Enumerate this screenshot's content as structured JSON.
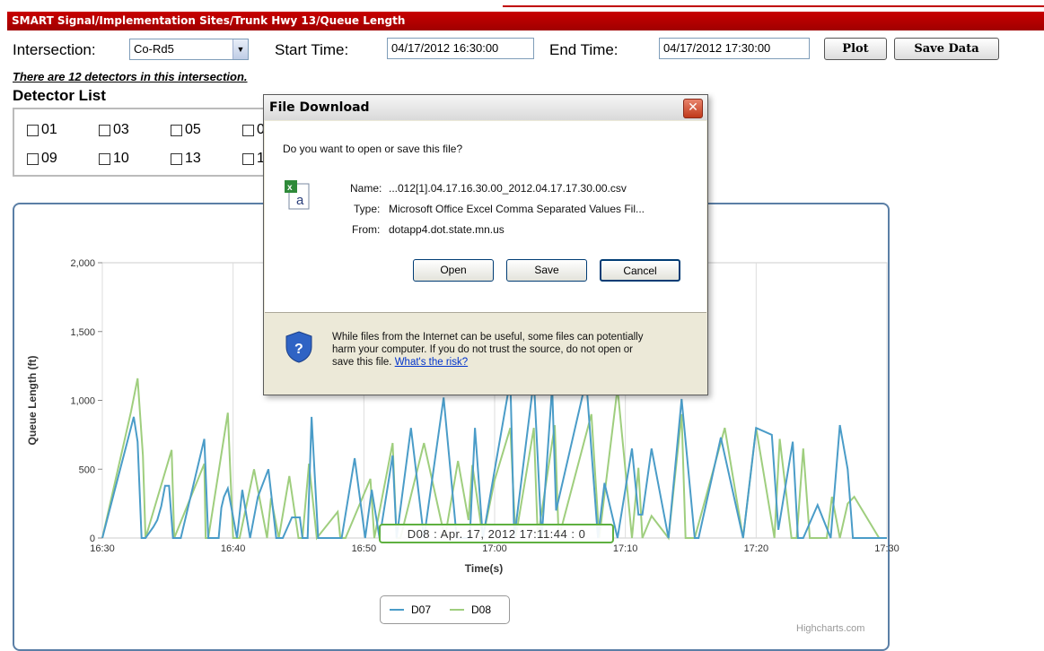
{
  "window": {
    "title": "SMART Signal/Implementation Sites/Trunk Hwy 13/Queue Length"
  },
  "controls": {
    "intersection_label": "Intersection:",
    "intersection_value": "Co-Rd5",
    "start_label": "Start Time:",
    "start_value": "04/17/2012 16:30:00",
    "end_label": "End Time:",
    "end_value": "04/17/2012 17:30:00",
    "plot_label": "Plot",
    "save_data_label": "Save Data"
  },
  "info": {
    "detector_count_text": "There are 12 detectors in this intersection.",
    "detector_list_title": "Detector List"
  },
  "detectors": {
    "row1": [
      "01",
      "03",
      "05",
      "0"
    ],
    "row2": [
      "09",
      "10",
      "13",
      "1"
    ]
  },
  "dialog": {
    "title": "File Download",
    "question": "Do you want to open or save this file?",
    "name_label": "Name:",
    "name_value": "...012[1].04.17.16.30.00_2012.04.17.17.30.00.csv",
    "type_label": "Type:",
    "type_value": "Microsoft Office Excel Comma Separated Values Fil...",
    "from_label": "From:",
    "from_value": "dotapp4.dot.state.mn.us",
    "open_label": "Open",
    "save_label": "Save",
    "cancel_label": "Cancel",
    "warning_line1": "While files from the Internet can be useful, some files can potentially",
    "warning_line2": "harm your computer. If you do not trust the source, do not open or",
    "warning_line3": "save this file.",
    "risk_link": "What's the risk?"
  },
  "tooltip": {
    "text": "D08 : Apr. 17, 2012 17:11:44 : 0"
  },
  "credits": "Highcharts.com",
  "colors": {
    "title_bar": "#b80000",
    "series_d07": "#4a9cc8",
    "series_d08": "#9fce7e",
    "chart_border": "#5b7fa6"
  },
  "chart_data": {
    "type": "line",
    "ylabel": "Queue Length (ft)",
    "xlabel": "Time(s)",
    "ylim": [
      0,
      2000
    ],
    "yticks": [
      "0",
      "500",
      "1,000",
      "1,500",
      "2,000"
    ],
    "xticks": [
      "16:30",
      "16:40",
      "16:50",
      "17:00",
      "17:10",
      "17:20",
      "17:30"
    ],
    "series": [
      {
        "name": "D07",
        "color": "#4a9cc8",
        "x": [
          0,
          2.4,
          2.7,
          3.0,
          3.3,
          3.9,
          4.2,
          4.5,
          4.8,
          5.1,
          5.4,
          6.0,
          7.8,
          8.1,
          8.9,
          9.1,
          9.3,
          9.6,
          10.3,
          10.7,
          11.3,
          11.9,
          12.7,
          13.3,
          13.8,
          14.5,
          15.1,
          15.3,
          15.5,
          15.7,
          16.0,
          16.5,
          18.0,
          18.3,
          19.3,
          20.1,
          20.6,
          21.2,
          22.2,
          22.5,
          23.6,
          24.6,
          26.1,
          27.1,
          28.1,
          28.5,
          29.1,
          31.2,
          31.5,
          33.0,
          33.6,
          34.4,
          34.7,
          37.0,
          37.9,
          38.4,
          39.4,
          40.5,
          41.0,
          41.3,
          42.0,
          43.3,
          44.3,
          45.3,
          45.6,
          47.3,
          49.0,
          50.0,
          51.2,
          51.7,
          52.8,
          53.2,
          53.6,
          54.7,
          55.7,
          56.4,
          57.0,
          57.4,
          58.2,
          59.2,
          60.0
        ],
        "y": [
          0,
          880,
          700,
          0,
          0,
          80,
          130,
          230,
          380,
          380,
          0,
          0,
          720,
          0,
          0,
          220,
          300,
          360,
          0,
          350,
          0,
          300,
          500,
          0,
          0,
          150,
          150,
          0,
          0,
          0,
          880,
          0,
          0,
          0,
          580,
          0,
          350,
          0,
          600,
          0,
          800,
          0,
          1020,
          0,
          0,
          800,
          0,
          1150,
          0,
          1150,
          0,
          1100,
          200,
          1150,
          0,
          400,
          0,
          650,
          170,
          170,
          650,
          0,
          1010,
          0,
          0,
          730,
          0,
          800,
          750,
          60,
          700,
          0,
          0,
          240,
          0,
          820,
          500,
          0,
          0,
          0,
          0
        ]
      },
      {
        "name": "D08",
        "color": "#9fce7e",
        "x": [
          0,
          2.2,
          2.7,
          3.1,
          3.3,
          5.3,
          5.5,
          7.8,
          7.9,
          8.1,
          9.6,
          10.0,
          10.5,
          11.6,
          12.6,
          12.9,
          13.5,
          14.3,
          15.0,
          15.3,
          15.8,
          16.4,
          18.0,
          18.2,
          18.6,
          20.5,
          20.8,
          22.2,
          22.5,
          22.8,
          24.6,
          26.2,
          27.2,
          28.0,
          28.3,
          29.1,
          30.0,
          31.2,
          31.6,
          33.0,
          33.3,
          34.6,
          34.9,
          37.4,
          38.0,
          39.4,
          40.5,
          41.0,
          41.3,
          42.0,
          43.3,
          44.3,
          44.6,
          45.3,
          47.6,
          49.0,
          50.0,
          51.4,
          51.8,
          52.7,
          53.1,
          53.6,
          54.1,
          55.4,
          55.8,
          56.4,
          57.0,
          57.5,
          59.4,
          60.0
        ],
        "y": [
          0,
          920,
          1160,
          600,
          0,
          640,
          0,
          540,
          0,
          0,
          910,
          0,
          0,
          500,
          0,
          290,
          0,
          450,
          0,
          0,
          540,
          0,
          190,
          0,
          0,
          430,
          0,
          690,
          0,
          0,
          690,
          0,
          560,
          130,
          530,
          0,
          420,
          800,
          0,
          800,
          0,
          820,
          0,
          900,
          0,
          1090,
          0,
          510,
          0,
          160,
          0,
          900,
          0,
          0,
          800,
          0,
          800,
          0,
          720,
          0,
          0,
          650,
          0,
          0,
          300,
          0,
          250,
          300,
          0,
          0
        ]
      }
    ]
  }
}
